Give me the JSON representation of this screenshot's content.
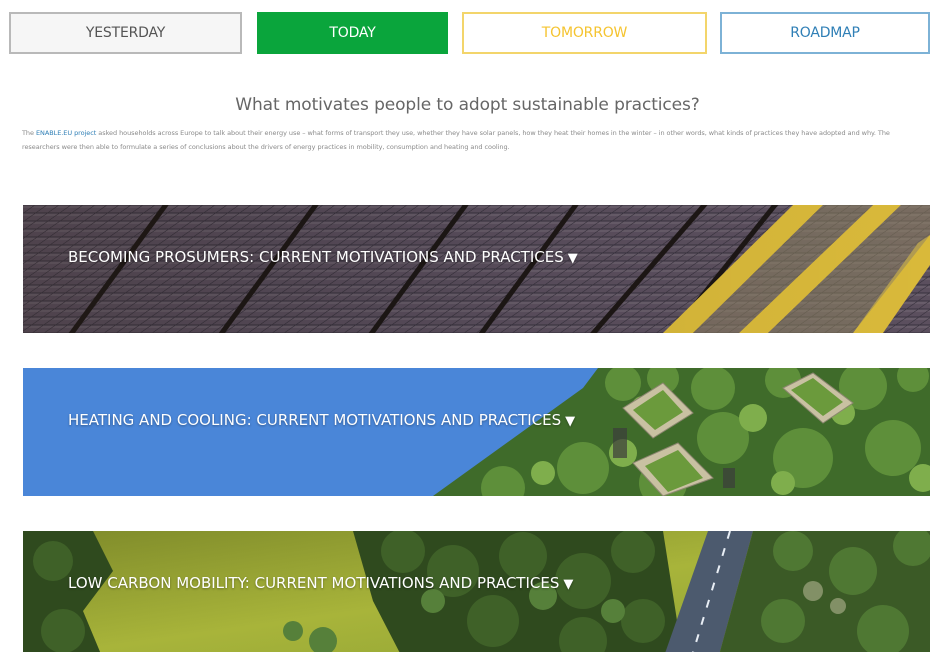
{
  "nav": {
    "yesterday": "YESTERDAY",
    "today": "TODAY",
    "tomorrow": "TOMORROW",
    "roadmap": "ROADMAP"
  },
  "intro": {
    "title": "What motivates people to adopt sustainable practices?",
    "text_before_link": "The ",
    "link_text": "ENABLE.EU project",
    "text_after_link": " asked households across Europe to talk about their energy use – what forms of transport they use, whether they have solar panels, how they heat their homes in the winter – in other words, what kinds of practices they have adopted and why. The researchers were then able to formulate a series of conclusions about the drivers of energy practices in mobility, consumption and heating and cooling."
  },
  "sections": [
    {
      "label": "BECOMING PROSUMERS: CURRENT MOTIVATIONS AND PRACTICES",
      "arrow": "▼"
    },
    {
      "label": "HEATING AND COOLING: CURRENT MOTIVATIONS AND PRACTICES",
      "arrow": "▼"
    },
    {
      "label": "LOW CARBON MOBILITY: CURRENT MOTIVATIONS AND PRACTICES",
      "arrow": "▼"
    }
  ],
  "colors": {
    "today_green": "#0aa53c",
    "tomorrow_yellow": "#f5c430",
    "roadmap_blue": "#2f7fb6",
    "heating_blue": "#4a86d8"
  }
}
